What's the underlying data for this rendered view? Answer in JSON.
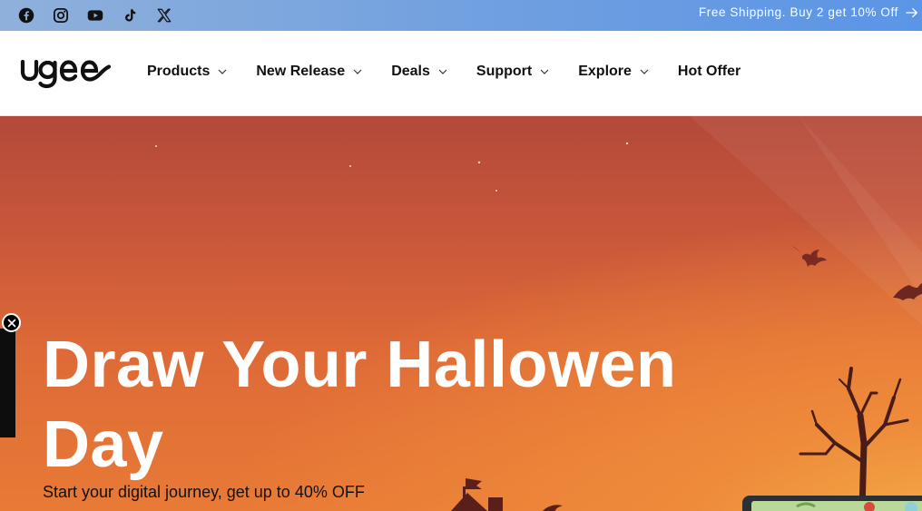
{
  "announcement": {
    "text": "Free Shipping. Buy 2 get 10% Off",
    "icon": "arrow-right-icon"
  },
  "social": [
    {
      "name": "Facebook",
      "icon": "facebook-icon"
    },
    {
      "name": "Instagram",
      "icon": "instagram-icon"
    },
    {
      "name": "YouTube",
      "icon": "youtube-icon"
    },
    {
      "name": "TikTok",
      "icon": "tiktok-icon"
    },
    {
      "name": "X",
      "icon": "x-icon"
    }
  ],
  "header": {
    "logo_text": "ugee",
    "nav": [
      {
        "label": "Products",
        "has_dropdown": true
      },
      {
        "label": "New Release",
        "has_dropdown": true
      },
      {
        "label": "Deals",
        "has_dropdown": true
      },
      {
        "label": "Support",
        "has_dropdown": true
      },
      {
        "label": "Explore",
        "has_dropdown": true
      },
      {
        "label": "Hot Offer",
        "has_dropdown": false
      }
    ]
  },
  "hero": {
    "title_line1": "Draw Your Hallowen",
    "title_line2": "Day",
    "subtitle": "Start your digital journey, get up to 40% OFF"
  },
  "colors": {
    "topbar": "#6f9fe0",
    "hero_top": "#b4493a",
    "hero_bottom": "#e87a36",
    "text_dark": "#111111"
  }
}
